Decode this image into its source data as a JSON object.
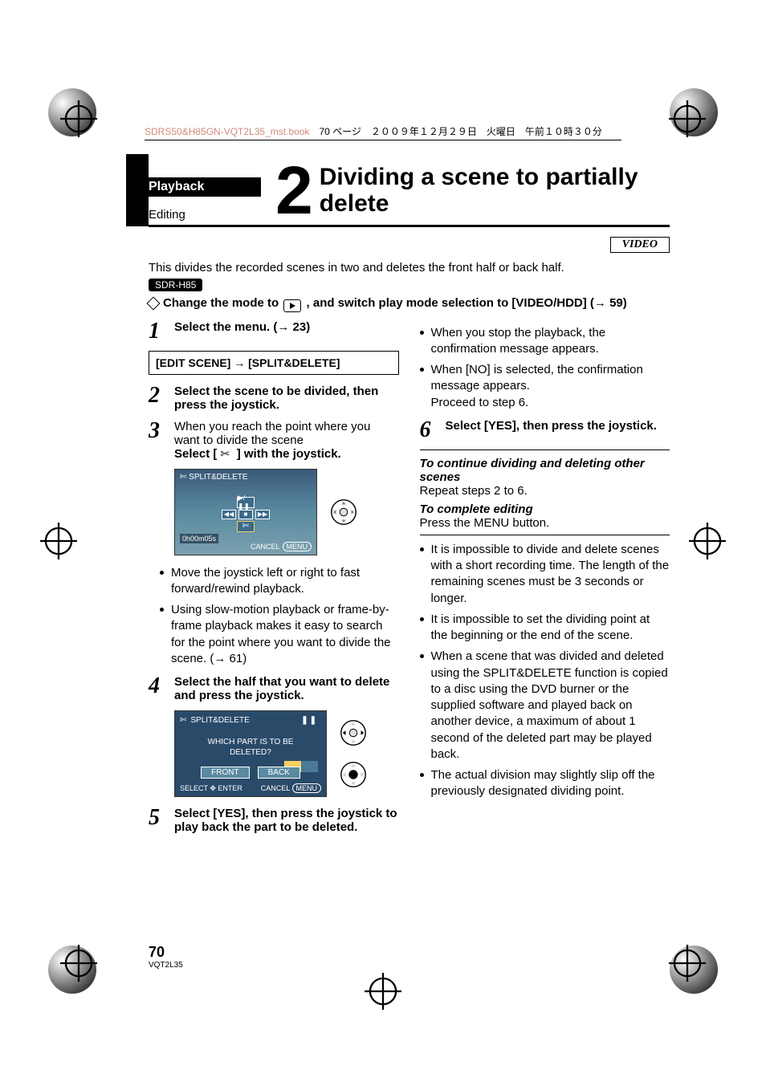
{
  "print_header": {
    "filename": "SDRS50&H85GN-VQT2L35_mst.book",
    "pageinfo": "70 ページ　２００９年１２月２９日　火曜日　午前１０時３０分"
  },
  "header": {
    "category": "Playback",
    "subcategory": "Editing",
    "number": "2",
    "title": "Dividing a scene to partially delete"
  },
  "video_tag": "VIDEO",
  "intro": "This divides the recorded scenes in two and deletes the front half or back half.",
  "model": "SDR-H85",
  "diamond_before": "Change the mode to ",
  "diamond_after": " , and switch play mode selection to [VIDEO/HDD] (→ 59)",
  "steps": {
    "s1": "Select the menu. (→ 23)",
    "menu_path": "[EDIT SCENE] → [SPLIT&DELETE]",
    "s2": "Select the scene to be divided, then press the joystick.",
    "s3a": "When you reach the point where you want to divide the scene",
    "s3b_pre": "Select [ ",
    "s3b_post": " ] with the joystick.",
    "s4": "Select the half that you want to delete and press the joystick.",
    "s5": "Select [YES], then press the joystick to play back the part to be deleted.",
    "s6": "Select [YES], then press the joystick."
  },
  "left_bullets": [
    "Move the joystick left or right to fast forward/rewind playback.",
    "Using slow-motion playback or frame-by-frame playback makes it easy to search for the point where you want to divide the scene. (→ 61)"
  ],
  "right_bullets_a": [
    "When you stop the playback, the confirmation message appears.",
    "When [NO] is selected, the confirmation message appears.\nProceed to step 6."
  ],
  "cont": {
    "h1": "To continue dividing and deleting other scenes",
    "p1": "Repeat steps 2 to 6.",
    "h2": "To complete editing",
    "p2": "Press the MENU button."
  },
  "notes": [
    "It is impossible to divide and delete scenes with a short recording time. The length of the remaining scenes must be 3 seconds or longer.",
    "It is impossible to set the dividing point at the beginning or the end of the scene.",
    "When a scene that was divided and deleted using the SPLIT&DELETE function is copied to a disc using the DVD burner or the supplied software and played back on another device, a maximum of about 1 second of the deleted part may be played back.",
    "The actual division may slightly slip off the previously designated dividing point."
  ],
  "screenshot1": {
    "title": "✄ SPLIT&DELETE",
    "tc": "0h00m05s",
    "cancel": "CANCEL",
    "menu": "MENU"
  },
  "screenshot2": {
    "title": "SPLIT&DELETE",
    "pause": "❚❚",
    "msg": "WHICH PART IS TO BE\nDELETED?",
    "front": "FRONT",
    "back": "BACK",
    "select": "SELECT",
    "enter": "ENTER",
    "cancel": "CANCEL",
    "menu": "MENU"
  },
  "footer": {
    "page": "70",
    "code": "VQT2L35"
  }
}
